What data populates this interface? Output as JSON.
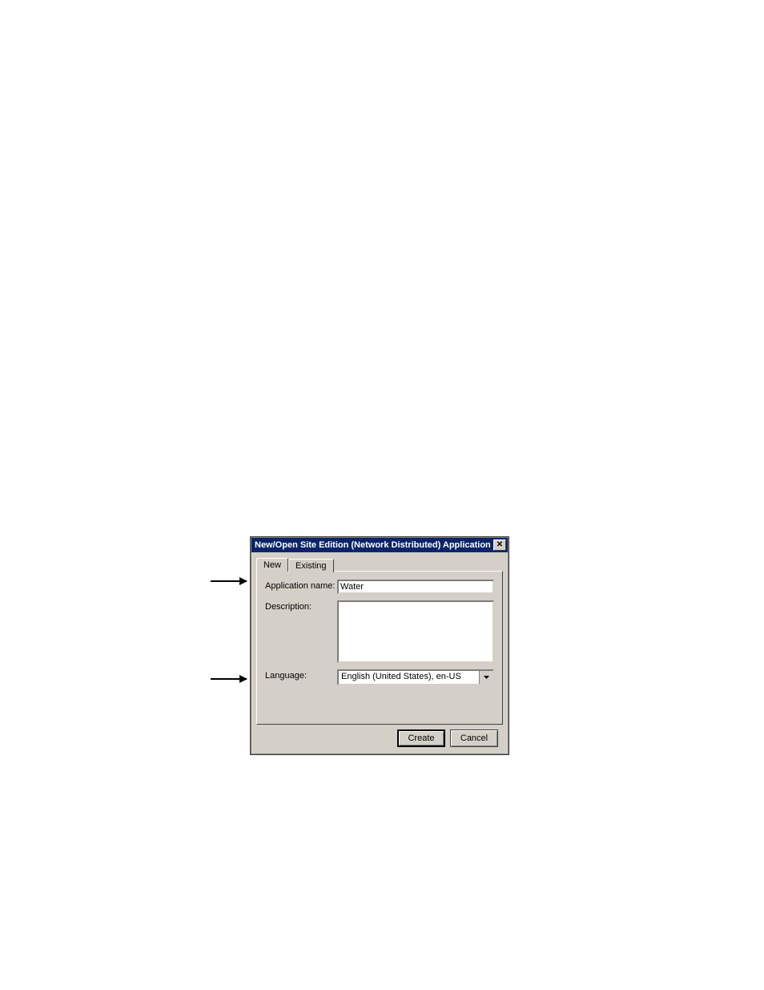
{
  "dialog": {
    "title": "New/Open Site Edition (Network Distributed) Application",
    "tabs": {
      "new": "New",
      "existing": "Existing"
    },
    "labels": {
      "application_name": "Application name:",
      "description": "Description:",
      "language": "Language:"
    },
    "fields": {
      "application_name_value": "Water",
      "description_value": "",
      "language_value": "English (United States), en-US"
    },
    "buttons": {
      "create": "Create",
      "cancel": "Cancel"
    }
  }
}
